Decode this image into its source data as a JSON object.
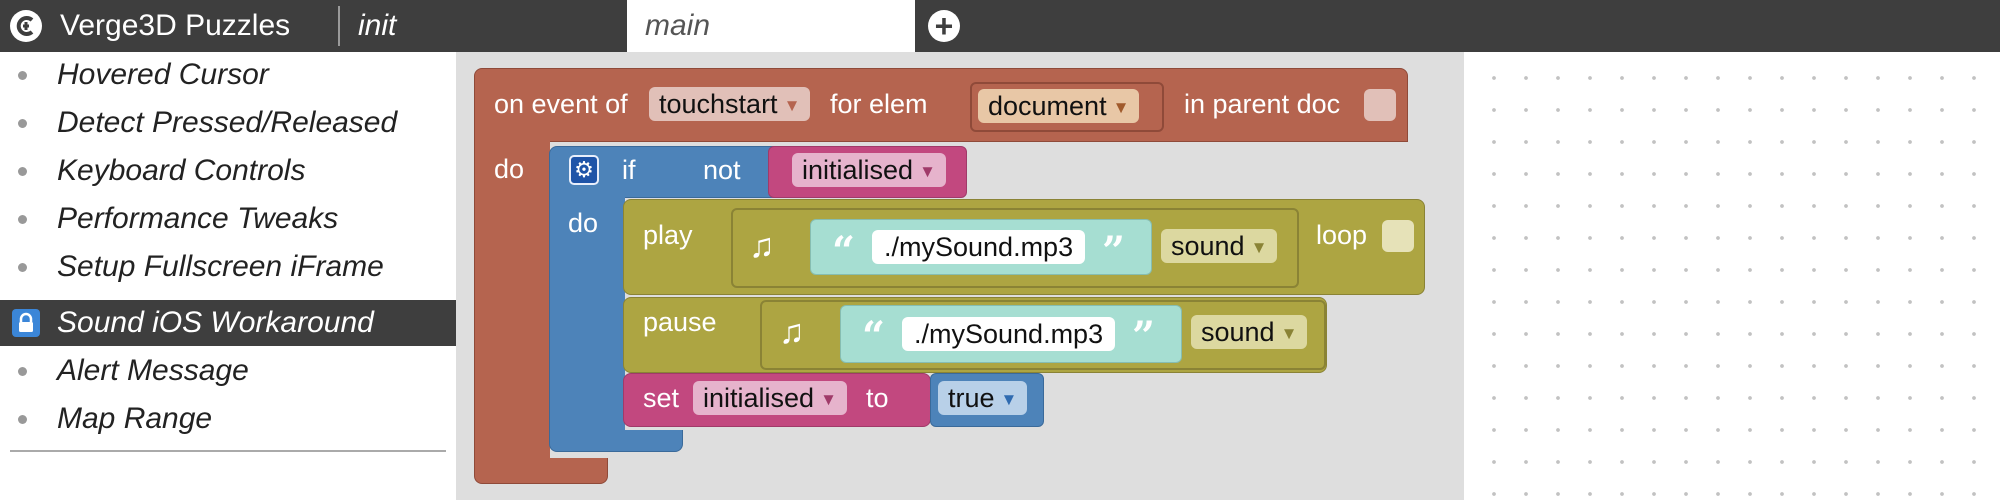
{
  "app": {
    "title": "Verge3D Puzzles"
  },
  "tabs": {
    "init": "init",
    "main": "main",
    "add": "+"
  },
  "sidebar": {
    "items": [
      {
        "label": "Hovered Cursor",
        "icon": "bullet"
      },
      {
        "label": "Detect Pressed/Released",
        "icon": "bullet"
      },
      {
        "label": "Keyboard Controls",
        "icon": "bullet"
      },
      {
        "label": "Performance Tweaks",
        "icon": "bullet"
      },
      {
        "label": "Setup Fullscreen iFrame",
        "icon": "bullet"
      },
      {
        "label": "Sound iOS Workaround",
        "icon": "lock-icon",
        "selected": true
      },
      {
        "label": "Alert Message",
        "icon": "bullet"
      },
      {
        "label": "Map Range",
        "icon": "bullet"
      }
    ]
  },
  "workspace": {
    "event_block": {
      "on_event_of": "on event of",
      "event": "touchstart",
      "for_elem": "for elem",
      "element": "document",
      "in_parent_doc": "in parent doc",
      "do": "do",
      "color": "#b5644f"
    },
    "if_block": {
      "if": "if",
      "not": "not",
      "variable": "initialised",
      "do": "do",
      "color": "#4d83b9"
    },
    "play_block": {
      "label": "play",
      "file": "./mySound.mp3",
      "type": "sound",
      "loop": "loop",
      "color": "#ada542"
    },
    "pause_block": {
      "label": "pause",
      "file": "./mySound.mp3",
      "type": "sound",
      "color": "#ada542"
    },
    "set_block": {
      "set": "set",
      "variable": "initialised",
      "to": "to",
      "value": "true",
      "color": "#c2487f"
    },
    "string_color": "#a6ded2",
    "quote_open": "“",
    "quote_close": "”"
  }
}
